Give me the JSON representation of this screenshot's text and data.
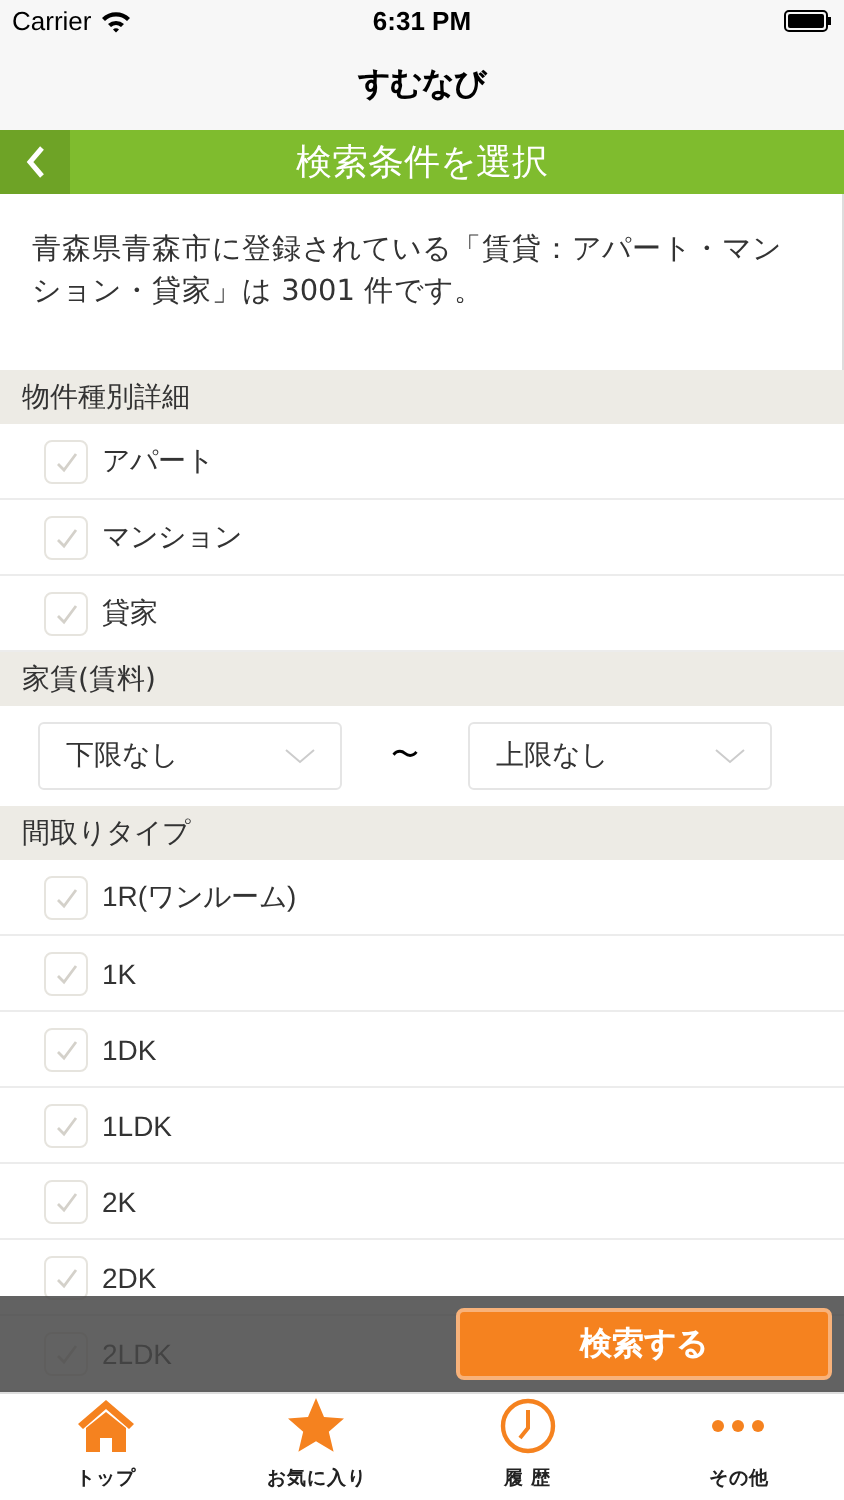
{
  "status_bar": {
    "carrier": "Carrier",
    "time": "6:31 PM"
  },
  "app_title": "すむなび",
  "header": {
    "title": "検索条件を選択"
  },
  "summary": "青森県青森市に登録されている「賃貸：アパート・マンション・貸家」は 3001 件です。",
  "sections": [
    {
      "kind": "checks",
      "title": "物件種別詳細",
      "items": [
        {
          "label": "アパート",
          "checked": false
        },
        {
          "label": "マンション",
          "checked": false
        },
        {
          "label": "貸家",
          "checked": false
        }
      ]
    },
    {
      "kind": "range",
      "title": "家賃(賃料)",
      "min": "下限なし",
      "separator": "〜",
      "max": "上限なし"
    },
    {
      "kind": "checks",
      "title": "間取りタイプ",
      "items": [
        {
          "label": "1R(ワンルーム)",
          "checked": false
        },
        {
          "label": "1K",
          "checked": false
        },
        {
          "label": "1DK",
          "checked": false
        },
        {
          "label": "1LDK",
          "checked": false
        },
        {
          "label": "2K",
          "checked": false
        },
        {
          "label": "2DK",
          "checked": false
        },
        {
          "label": "2LDK",
          "checked": false
        }
      ]
    }
  ],
  "search_button": "検索する",
  "tabs": [
    {
      "kind": "home",
      "label": "トップ"
    },
    {
      "kind": "star",
      "label": "お気に入り"
    },
    {
      "kind": "clock",
      "label": "履 歴"
    },
    {
      "kind": "more",
      "label": "その他"
    }
  ]
}
